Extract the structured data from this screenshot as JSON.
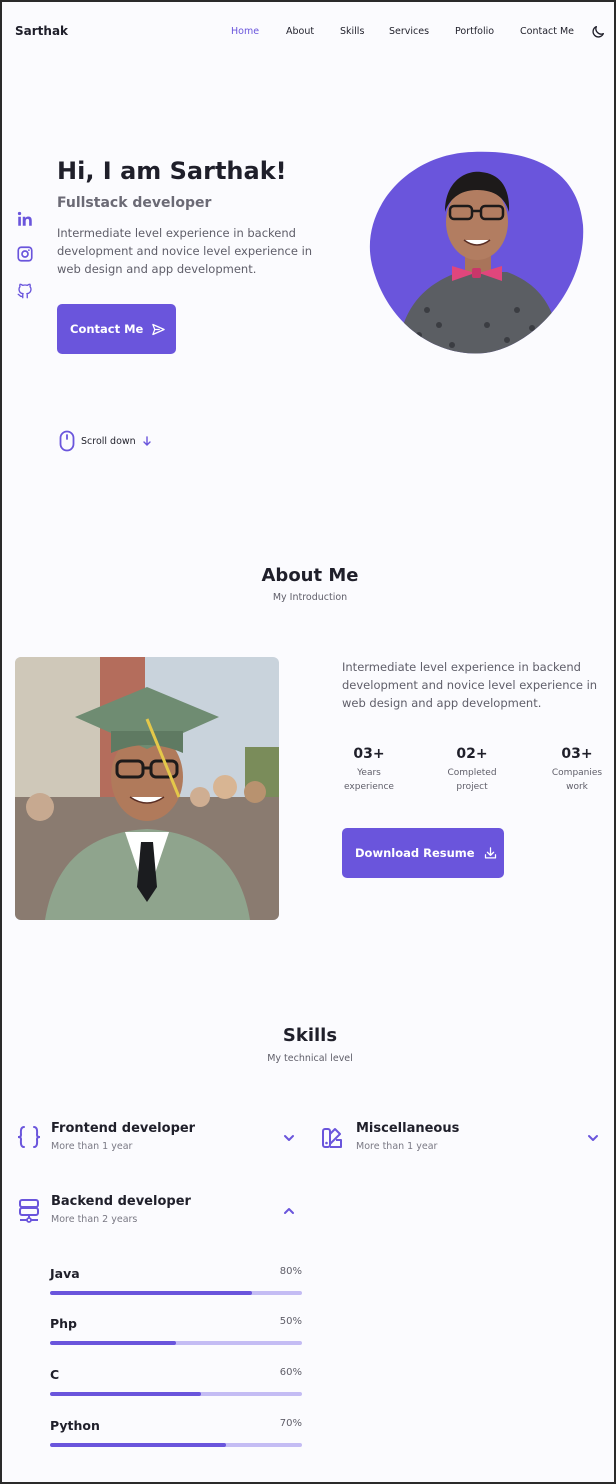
{
  "brand": "Sarthak",
  "nav": [
    "Home",
    "About",
    "Skills",
    "Services",
    "Portfolio",
    "Contact Me"
  ],
  "social": [
    "linkedin-icon",
    "instagram-icon",
    "github-icon"
  ],
  "hero": {
    "title": "Hi, I am Sarthak!",
    "subtitle": "Fullstack developer",
    "description": "Intermediate level experience in backend development and novice level experience in web design and app development.",
    "cta": "Contact Me"
  },
  "scroll": "Scroll down",
  "about": {
    "title": "About Me",
    "subtitle": "My Introduction",
    "description": "Intermediate level experience in backend development and novice level experience in web design and app development.",
    "stats": [
      {
        "num": "03+",
        "line1": "Years",
        "line2": "experience"
      },
      {
        "num": "02+",
        "line1": "Completed",
        "line2": "project"
      },
      {
        "num": "03+",
        "line1": "Companies",
        "line2": "work"
      }
    ],
    "resume": "Download Resume"
  },
  "skills": {
    "title": "Skills",
    "subtitle": "My technical level",
    "groups": [
      {
        "title": "Frontend developer",
        "sub": "More than 1 year",
        "expanded": false
      },
      {
        "title": "Miscellaneous",
        "sub": "More than 1 year",
        "expanded": false
      },
      {
        "title": "Backend developer",
        "sub": "More than 2 years",
        "expanded": true
      }
    ],
    "backend": [
      {
        "name": "Java",
        "pct": "80%",
        "value": 80
      },
      {
        "name": "Php",
        "pct": "50%",
        "value": 50
      },
      {
        "name": "C",
        "pct": "60%",
        "value": 60
      },
      {
        "name": "Python",
        "pct": "70%",
        "value": 70
      }
    ]
  },
  "colors": {
    "accent": "#6a55dc",
    "accent_light": "#c4bcf4"
  }
}
